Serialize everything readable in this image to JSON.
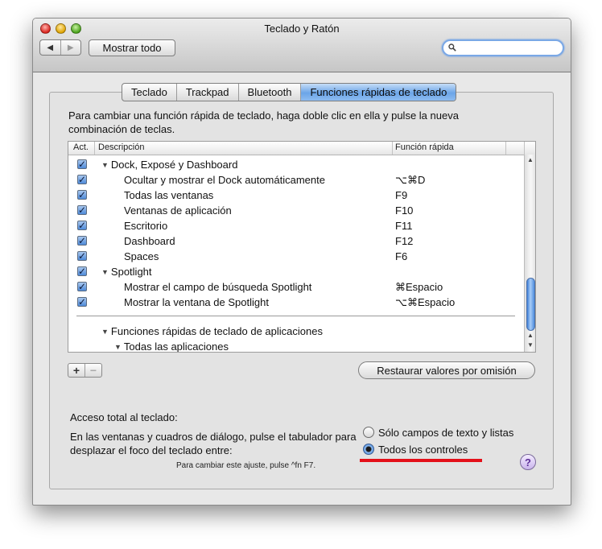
{
  "window": {
    "title": "Teclado y Ratón"
  },
  "toolbar": {
    "back_icon": "◀",
    "forward_icon": "▶",
    "show_all": "Mostrar todo",
    "search_placeholder": ""
  },
  "tabs": [
    {
      "label": "Teclado",
      "active": false
    },
    {
      "label": "Trackpad",
      "active": false
    },
    {
      "label": "Bluetooth",
      "active": false
    },
    {
      "label": "Funciones rápidas de teclado",
      "active": true
    }
  ],
  "instructions": "Para cambiar una función rápida de teclado, haga doble clic en ella y pulse la nueva combinación de teclas.",
  "table": {
    "headers": {
      "act": "Act.",
      "desc": "Descripción",
      "func": "Función rápida"
    },
    "rows": [
      {
        "checked": true,
        "level": 0,
        "group": true,
        "desc": "Dock, Exposé y Dashboard",
        "func": ""
      },
      {
        "checked": true,
        "level": 1,
        "group": false,
        "desc": "Ocultar y mostrar el Dock automáticamente",
        "func": "⌥⌘D"
      },
      {
        "checked": true,
        "level": 1,
        "group": false,
        "desc": "Todas las ventanas",
        "func": "F9"
      },
      {
        "checked": true,
        "level": 1,
        "group": false,
        "desc": "Ventanas de aplicación",
        "func": "F10"
      },
      {
        "checked": true,
        "level": 1,
        "group": false,
        "desc": "Escritorio",
        "func": "F11"
      },
      {
        "checked": true,
        "level": 1,
        "group": false,
        "desc": "Dashboard",
        "func": "F12"
      },
      {
        "checked": true,
        "level": 1,
        "group": false,
        "desc": "Spaces",
        "func": "F6"
      },
      {
        "checked": true,
        "level": 0,
        "group": true,
        "desc": "Spotlight",
        "func": ""
      },
      {
        "checked": true,
        "level": 1,
        "group": false,
        "desc": "Mostrar el campo de búsqueda Spotlight",
        "func": "⌘Espacio"
      },
      {
        "checked": true,
        "level": 1,
        "group": false,
        "desc": "Mostrar la ventana de Spotlight",
        "func": "⌥⌘Espacio"
      }
    ],
    "app_rows": [
      {
        "desc": "Funciones rápidas de teclado de aplicaciones"
      },
      {
        "desc": "Todas las aplicaciones"
      }
    ]
  },
  "buttons": {
    "plus": "+",
    "minus": "−",
    "restore": "Restaurar valores por omisión",
    "help": "?"
  },
  "keyboard_access": {
    "title": "Acceso total al teclado:",
    "description": "En las ventanas y cuadros de diálogo, pulse el tabulador para desplazar el foco del teclado entre:",
    "options": [
      {
        "label": "Sólo campos de texto y listas",
        "selected": false
      },
      {
        "label": "Todos los controles",
        "selected": true
      }
    ],
    "hint": "Para cambiar este ajuste, pulse ^fn F7."
  },
  "colors": {
    "tab_active": "#6ba5e8",
    "highlight_underline": "#e4101a",
    "search_focus": "#7aa8e6"
  }
}
